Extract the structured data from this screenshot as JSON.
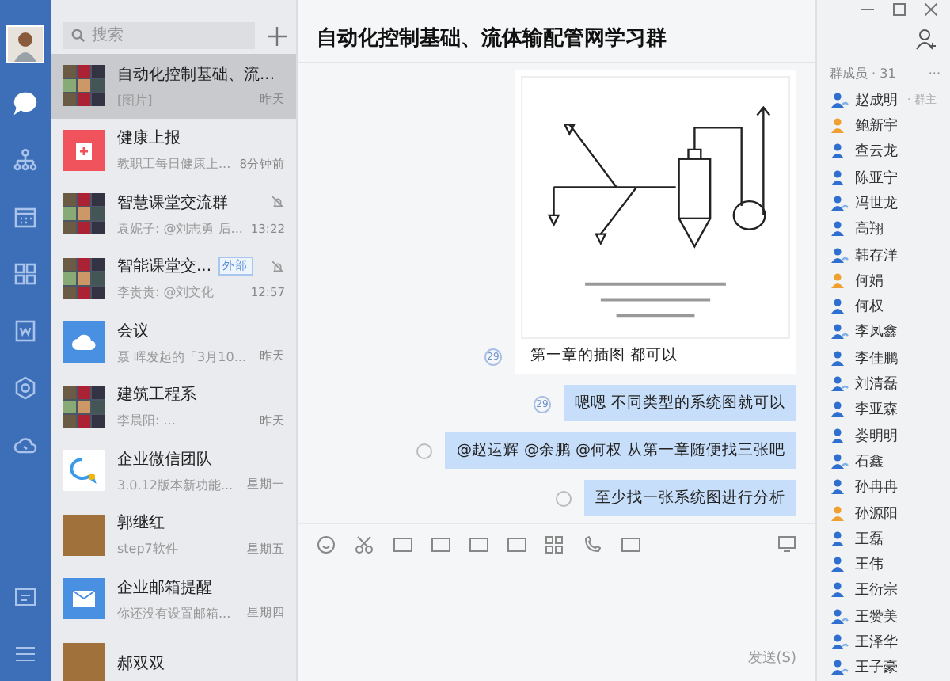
{
  "window": {
    "title": "自动化控制基础、流体输配管网学习群"
  },
  "nav": {
    "items": [
      {
        "kind": "chat",
        "selected": true
      },
      {
        "kind": "org",
        "selected": false
      },
      {
        "kind": "calendar",
        "selected": false
      },
      {
        "kind": "apps",
        "selected": false
      },
      {
        "kind": "doc",
        "selected": false
      },
      {
        "kind": "disk",
        "selected": false
      },
      {
        "kind": "cloud",
        "selected": false
      }
    ]
  },
  "search": {
    "placeholder": "搜索"
  },
  "chats": [
    {
      "title": "自动化控制基础、流...",
      "preview": "[图片]",
      "time": "昨天",
      "kind": "group",
      "selected": true,
      "muted": false
    },
    {
      "title": "健康上报",
      "preview": "教职工每日健康上...",
      "time": "8分钟前",
      "kind": "health",
      "selected": false,
      "muted": false
    },
    {
      "title": "智慧课堂交流群",
      "preview": "袁妮子: @刘志勇 后...",
      "time": "13:22",
      "kind": "group",
      "selected": false,
      "muted": true
    },
    {
      "title": "智能课堂交...",
      "tag": "外部",
      "preview": "李贵贵: @刘文化",
      "time": "12:57",
      "kind": "group",
      "selected": false,
      "muted": true
    },
    {
      "title": "会议",
      "preview": "聂 晖发起的「3月10...",
      "time": "昨天",
      "kind": "meeting",
      "selected": false,
      "muted": false
    },
    {
      "title": "建筑工程系",
      "preview": "李晨阳: ...",
      "time": "昨天",
      "kind": "group",
      "selected": false,
      "muted": false
    },
    {
      "title": "企业微信团队",
      "preview": "3.0.12版本新功能...",
      "time": "星期一",
      "kind": "team",
      "selected": false,
      "muted": false
    },
    {
      "title": "郭继红",
      "preview": "step7软件",
      "time": "星期五",
      "kind": "photo",
      "selected": false,
      "muted": false
    },
    {
      "title": "企业邮箱提醒",
      "preview": "你还没有设置邮箱...",
      "time": "星期四",
      "kind": "mail",
      "selected": false,
      "muted": false
    },
    {
      "title": "郝双双",
      "kind": "photo",
      "selected": false,
      "muted": false
    }
  ],
  "messages": [
    {
      "kind": "image",
      "mine": false,
      "read": "29",
      "text": "第一章的插图  都可以"
    },
    {
      "kind": "text",
      "mine": true,
      "read": "29",
      "text": "嗯嗯  不同类型的系统图就可以"
    },
    {
      "kind": "text",
      "mine": true,
      "text": "@赵运辉  @余鹏  @何权  从第一章随便找三张吧"
    },
    {
      "kind": "text",
      "mine": true,
      "text": "至少找一张系统图进行分析"
    }
  ],
  "send_button": "发送(S)",
  "members": {
    "title": "群成员 · 31",
    "more": "···",
    "items": [
      {
        "name": "赵成明",
        "role": "· 群主",
        "color": "#2f6fd0",
        "linked": true
      },
      {
        "name": "鲍新宇",
        "color": "#f0a030",
        "linked": false
      },
      {
        "name": "查云龙",
        "color": "#2f6fd0",
        "linked": false
      },
      {
        "name": "陈亚宁",
        "color": "#2f6fd0",
        "linked": false
      },
      {
        "name": "冯世龙",
        "color": "#2f6fd0",
        "linked": true
      },
      {
        "name": "高翔",
        "color": "#2f6fd0",
        "linked": false
      },
      {
        "name": "韩存洋",
        "color": "#2f6fd0",
        "linked": true
      },
      {
        "name": "何娟",
        "color": "#f0a030",
        "linked": false
      },
      {
        "name": "何权",
        "color": "#2f6fd0",
        "linked": false
      },
      {
        "name": "李凤鑫",
        "color": "#2f6fd0",
        "linked": true
      },
      {
        "name": "李佳鹏",
        "color": "#2f6fd0",
        "linked": false
      },
      {
        "name": "刘清磊",
        "color": "#2f6fd0",
        "linked": true
      },
      {
        "name": "李亚森",
        "color": "#2f6fd0",
        "linked": false
      },
      {
        "name": "娄明明",
        "color": "#2f6fd0",
        "linked": false
      },
      {
        "name": "石鑫",
        "color": "#2f6fd0",
        "linked": true
      },
      {
        "name": "孙冉冉",
        "color": "#2f6fd0",
        "linked": false
      },
      {
        "name": "孙源阳",
        "color": "#f0a030",
        "linked": false
      },
      {
        "name": "王磊",
        "color": "#2f6fd0",
        "linked": false
      },
      {
        "name": "王伟",
        "color": "#2f6fd0",
        "linked": false
      },
      {
        "name": "王衍宗",
        "color": "#2f6fd0",
        "linked": false
      },
      {
        "name": "王赞美",
        "color": "#2f6fd0",
        "linked": true
      },
      {
        "name": "王泽华",
        "color": "#2f6fd0",
        "linked": true
      },
      {
        "name": "王子豪",
        "color": "#2f6fd0",
        "linked": true
      }
    ]
  }
}
